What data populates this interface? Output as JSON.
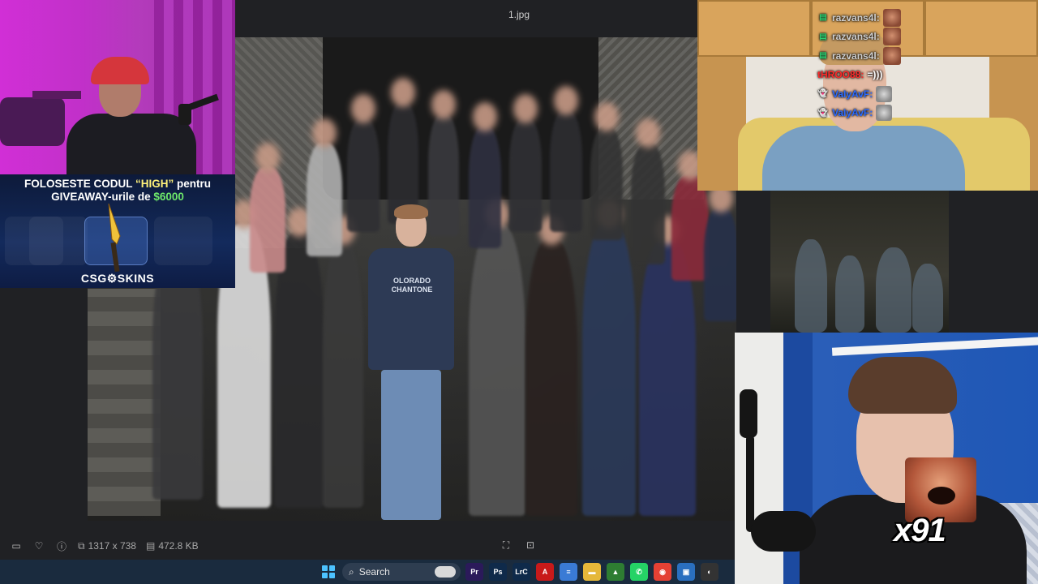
{
  "viewer": {
    "title": "1.jpg",
    "dimensions": "1317 x 738",
    "file_size": "472.8 KB",
    "shirt_text": "OLORADO\nCHANTONE"
  },
  "taskbar": {
    "search_label": "Search",
    "apps": [
      {
        "name": "premiere-pro-icon",
        "label": "Pr",
        "color": "#2b1a5a"
      },
      {
        "name": "photoshop-icon",
        "label": "Ps",
        "color": "#0f2a4a"
      },
      {
        "name": "lightroom-classic-icon",
        "label": "LrC",
        "color": "#0f2a4a"
      },
      {
        "name": "acrobat-icon",
        "label": "A",
        "color": "#c81a1a"
      },
      {
        "name": "notepad-icon",
        "label": "≡",
        "color": "#3a7bd5"
      },
      {
        "name": "file-explorer-icon",
        "label": "▬",
        "color": "#e5b83a"
      },
      {
        "name": "google-drive-icon",
        "label": "▲",
        "color": "#2e7d32"
      },
      {
        "name": "whatsapp-icon",
        "label": "✆",
        "color": "#25d366"
      },
      {
        "name": "chrome-icon",
        "label": "◉",
        "color": "#e44134"
      },
      {
        "name": "photos-icon",
        "label": "▣",
        "color": "#2a6fbf"
      },
      {
        "name": "obs-icon",
        "label": "◐",
        "color": "#333333"
      }
    ]
  },
  "promo": {
    "line1_a": "FOLOSESTE CODUL ",
    "line1_code": "“HIGH”",
    "line1_b": " pentru",
    "line2_a": "GIVEAWAY-urile de ",
    "line2_amount": "$6000",
    "brand": "CSG⚙SKINS"
  },
  "chat": {
    "messages": [
      {
        "user": "razvans4l:",
        "color": "#cfcfcf",
        "badge": "▤",
        "badge_color": "#2ecc71",
        "emote": true
      },
      {
        "user": "razvans4l:",
        "color": "#cfcfcf",
        "badge": "▤",
        "badge_color": "#2ecc71",
        "emote": true
      },
      {
        "user": "razvans4l:",
        "color": "#cfcfcf",
        "badge": "▤",
        "badge_color": "#2ecc71",
        "emote": true
      },
      {
        "user": "tHROO88:",
        "color": "#ff2a2a",
        "text": "=)))"
      },
      {
        "user": "VaIyAvF:",
        "color": "#2b6bff",
        "badge": "👻",
        "badge_color": "#4aa3ff",
        "emote": true
      },
      {
        "user": "VaIyAvF:",
        "color": "#2b6bff",
        "badge": "👻",
        "badge_color": "#4aa3ff",
        "emote": true
      }
    ]
  },
  "overlay": {
    "combo_text": "x91"
  }
}
